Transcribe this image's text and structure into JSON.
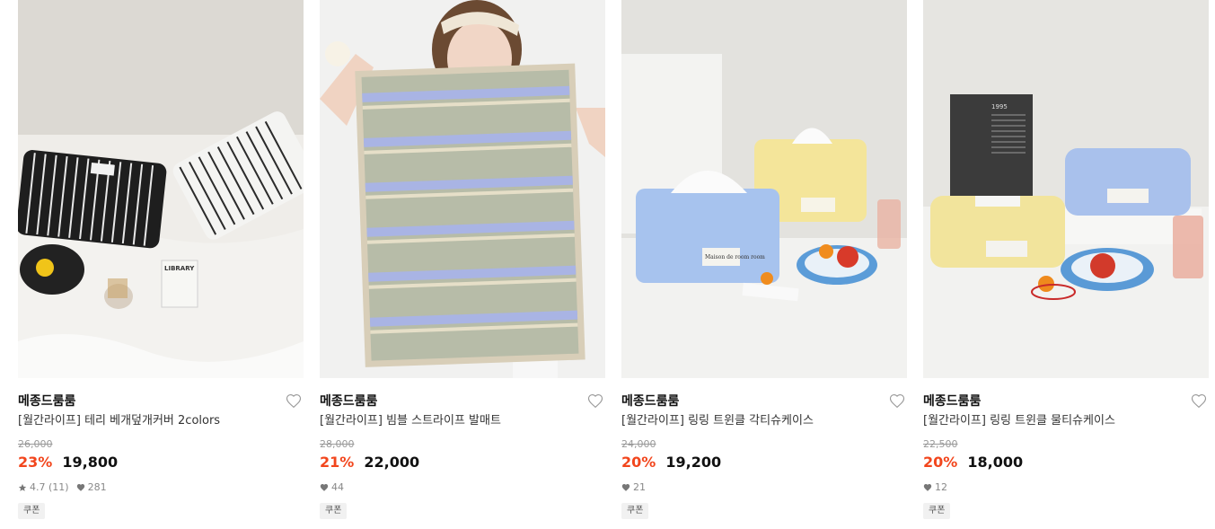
{
  "products": [
    {
      "brand": "메종드룸룸",
      "title": "[월간라이프] 테리 베개덮개커버 2colors",
      "original_price": "26,000",
      "discount": "23%",
      "price": "19,800",
      "rating": "4.7 (11)",
      "likes": "281",
      "coupon": "쿠폰",
      "photo_text": "LIBRARY",
      "has_rating": true
    },
    {
      "brand": "메종드룸룸",
      "title": "[월간라이프] 빔블 스트라이프 발매트",
      "original_price": "28,000",
      "discount": "21%",
      "price": "22,000",
      "rating": "",
      "likes": "44",
      "coupon": "쿠폰",
      "photo_text": "",
      "has_rating": false
    },
    {
      "brand": "메종드룸룸",
      "title": "[월간라이프] 링링 트윈클 각티슈케이스",
      "original_price": "24,000",
      "discount": "20%",
      "price": "19,200",
      "rating": "",
      "likes": "21",
      "coupon": "쿠폰",
      "photo_text": "Maison de room room",
      "has_rating": false
    },
    {
      "brand": "메종드룸룸",
      "title": "[월간라이프] 링링 트윈클 물티슈케이스",
      "original_price": "22,500",
      "discount": "20%",
      "price": "18,000",
      "rating": "",
      "likes": "12",
      "coupon": "쿠폰",
      "photo_text": "1995",
      "has_rating": false
    }
  ],
  "colors": {
    "discount": "#f2461d",
    "strike": "#999999",
    "coupon_bg": "#f1f1f1"
  }
}
